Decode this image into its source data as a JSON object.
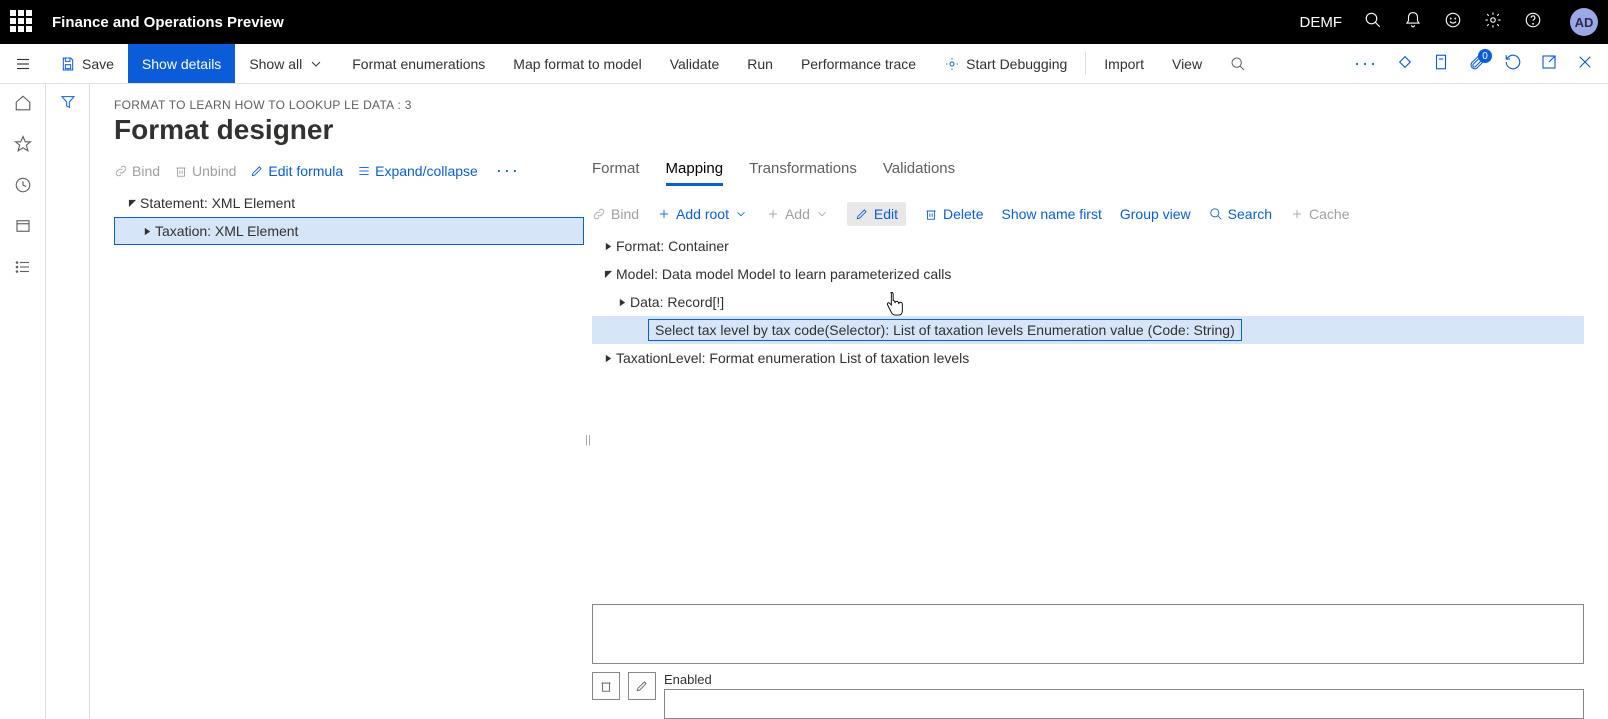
{
  "topbar": {
    "title": "Finance and Operations Preview",
    "company": "DEMF",
    "avatar": "AD"
  },
  "cmdbar": {
    "save": "Save",
    "show_details": "Show details",
    "show_all": "Show all",
    "format_enum": "Format enumerations",
    "map_format": "Map format to model",
    "validate": "Validate",
    "run": "Run",
    "perf": "Performance trace",
    "start_debug": "Start Debugging",
    "import": "Import",
    "view": "View",
    "badge_count": "0"
  },
  "header": {
    "breadcrumb": "FORMAT TO LEARN HOW TO LOOKUP LE DATA : 3",
    "title": "Format designer"
  },
  "leftpane": {
    "toolbar": {
      "bind": "Bind",
      "unbind": "Unbind",
      "edit_formula": "Edit formula",
      "expand": "Expand/collapse"
    },
    "tree": {
      "node1": "Statement: XML Element",
      "node2": "Taxation: XML Element"
    }
  },
  "rightpane": {
    "tabs": {
      "format": "Format",
      "mapping": "Mapping",
      "transformations": "Transformations",
      "validations": "Validations"
    },
    "toolbar": {
      "bind": "Bind",
      "add_root": "Add root",
      "add": "Add",
      "edit": "Edit",
      "delete": "Delete",
      "show_name_first": "Show name first",
      "group_view": "Group view",
      "search": "Search",
      "cache": "Cache"
    },
    "tree": {
      "n1": "Format: Container",
      "n2": "Model: Data model Model to learn parameterized calls",
      "n3": "Data: Record[!]",
      "n4": "Select tax level by tax code(Selector): List of taxation levels Enumeration value (Code: String)",
      "n5": "TaxationLevel: Format enumeration List of taxation levels"
    },
    "enabled_label": "Enabled"
  }
}
